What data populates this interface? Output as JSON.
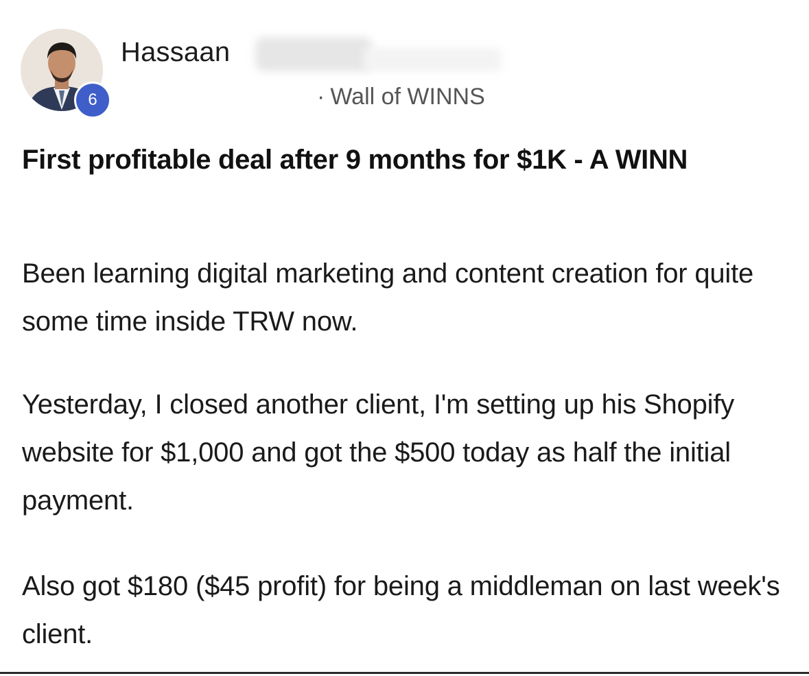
{
  "post": {
    "author": {
      "name": "Hassaan",
      "level": "6",
      "avatar_icon": "user-avatar-photo"
    },
    "channel": {
      "separator": "·",
      "name": "Wall of WINNS"
    },
    "title": "First profitable deal after 9 months for $1K - A WINN",
    "body": [
      "Been learning digital marketing and content creation for quite some time inside TRW now.",
      "Yesterday, I closed another client, I'm setting up his Shopify website for $1,000 and got the $500 today as half the initial payment.",
      "Also got $180 ($45 profit) for being a middleman on last week's client."
    ]
  },
  "colors": {
    "badge": "#3f5ec9",
    "channel_text": "#555555",
    "text": "#1a1a1a"
  }
}
